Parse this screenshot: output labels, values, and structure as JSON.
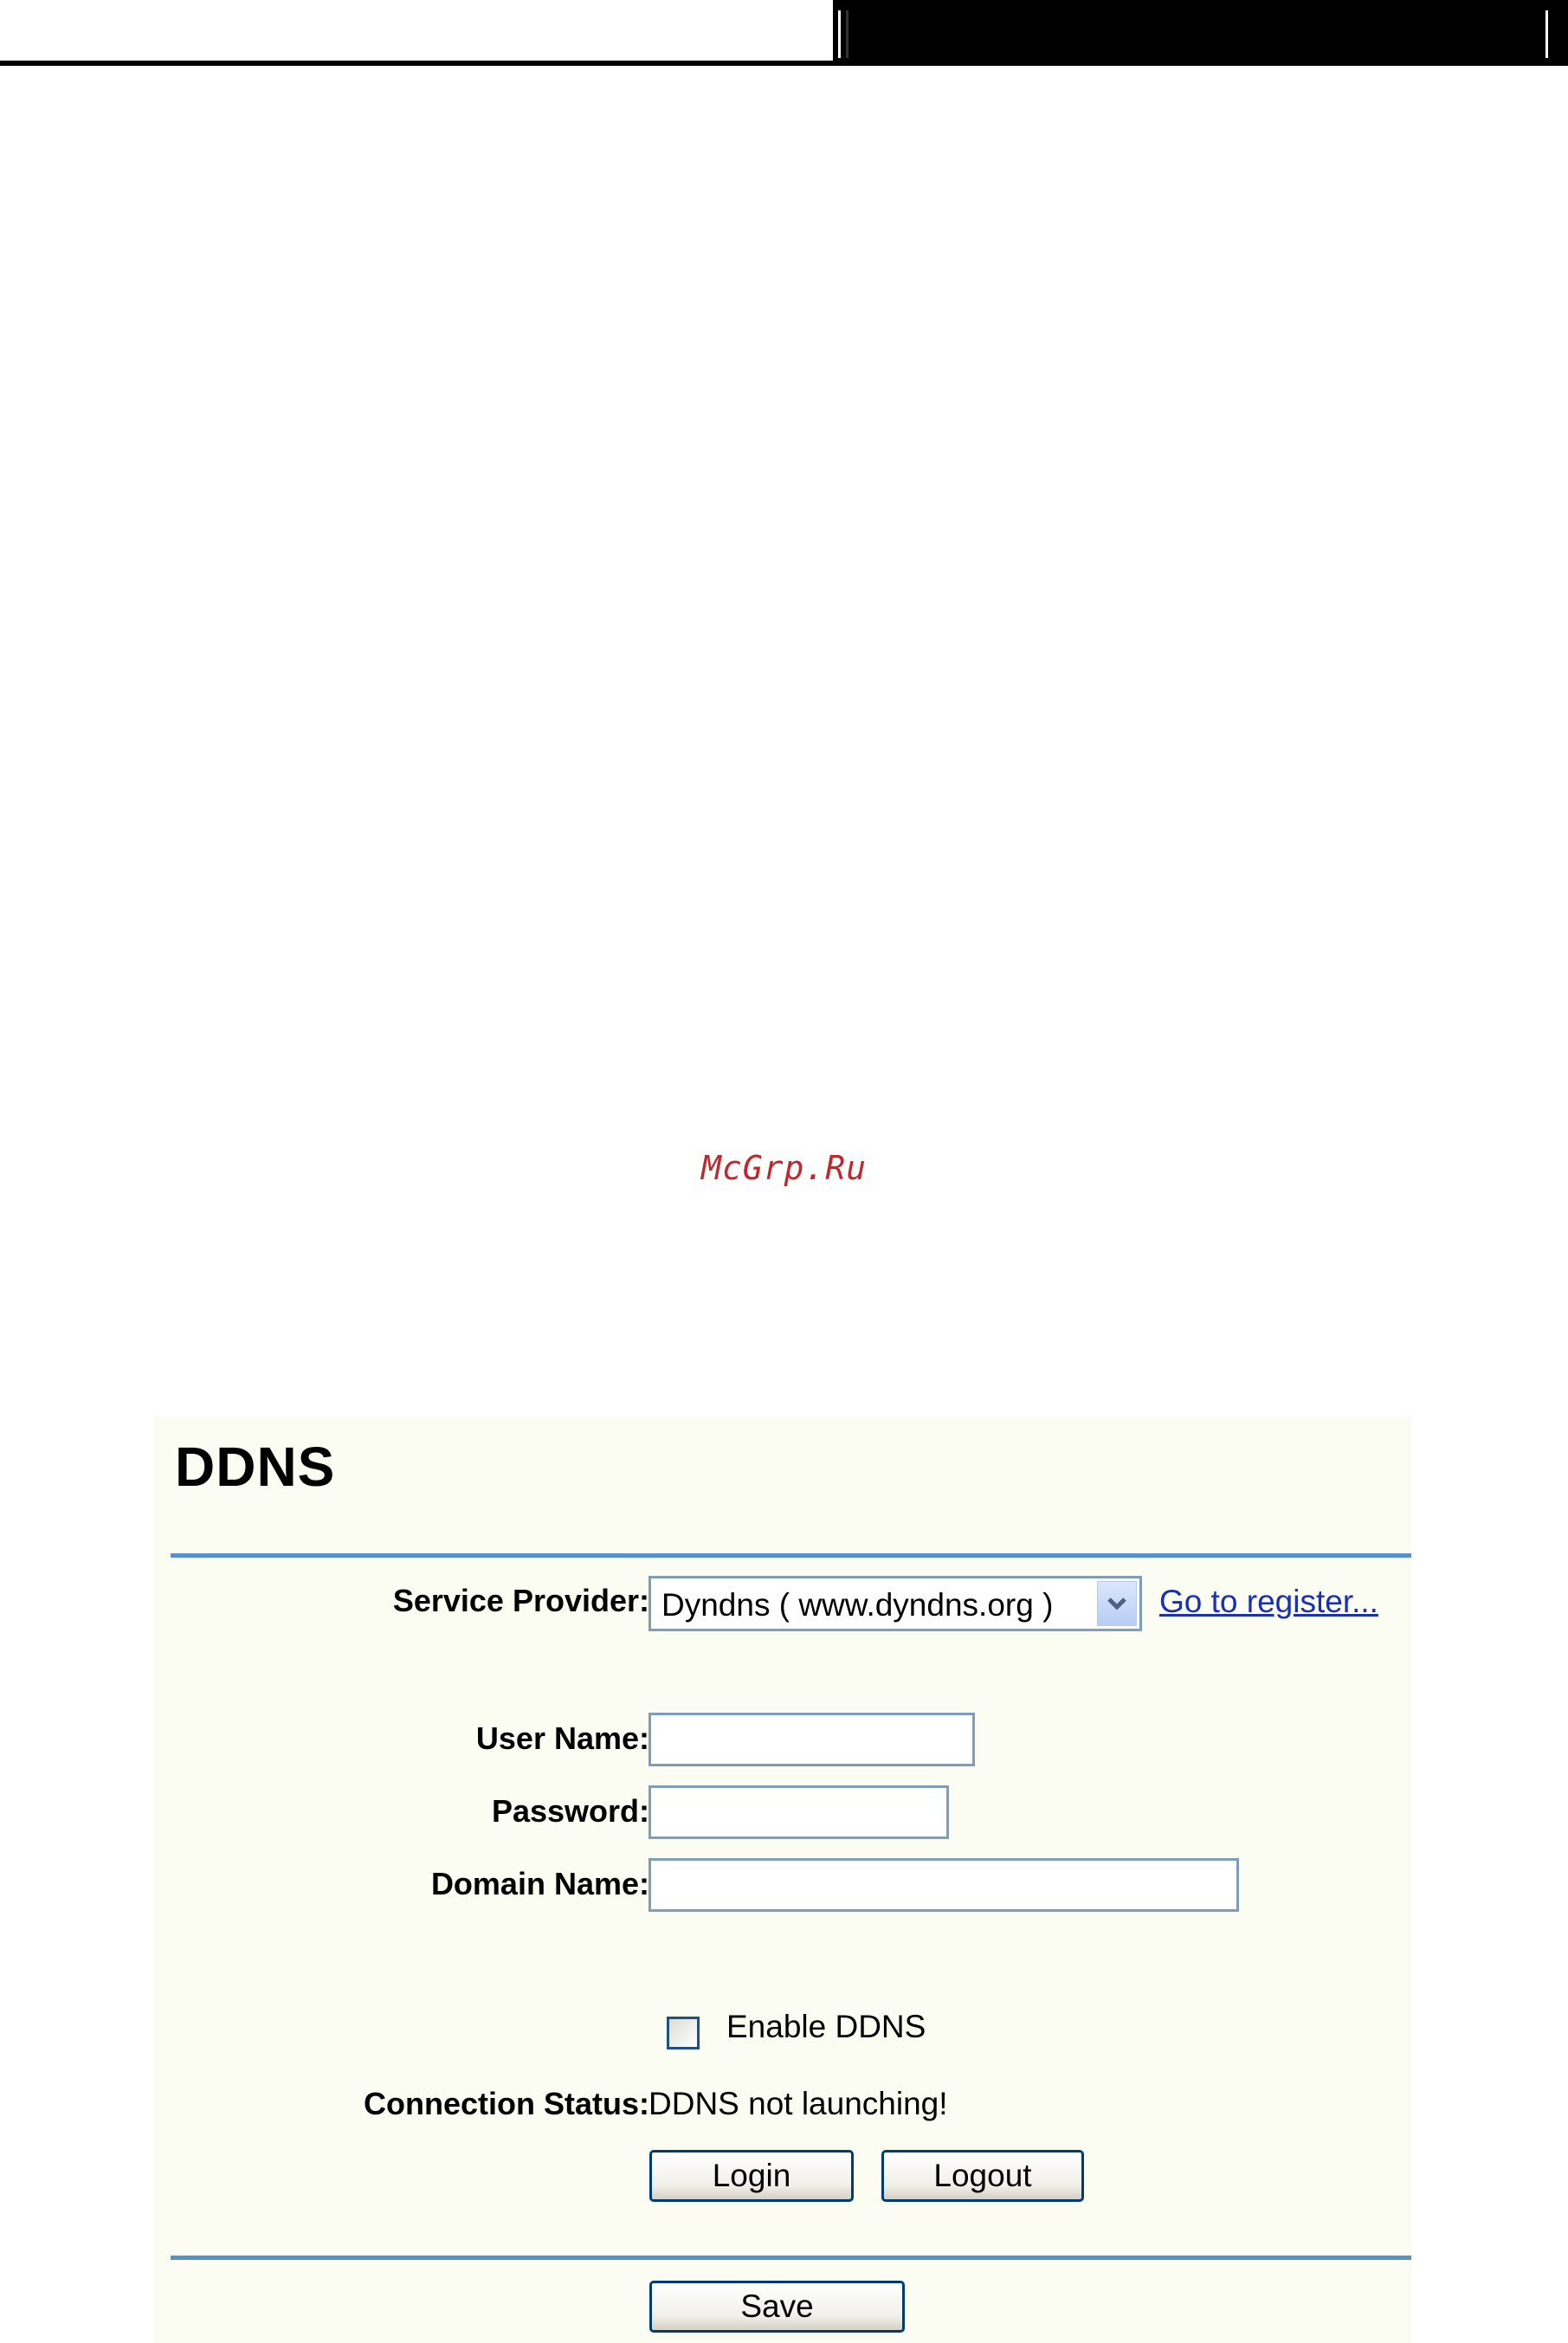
{
  "watermark": "McGrp.Ru",
  "panel": {
    "title": "DDNS",
    "service_provider": {
      "label": "Service Provider:",
      "selected": "Dyndns ( www.dyndns.org )",
      "link": "Go to register..."
    },
    "user_name": {
      "label": "User Name:",
      "value": ""
    },
    "password": {
      "label": "Password:",
      "value": ""
    },
    "domain_name": {
      "label": "Domain Name:",
      "value": ""
    },
    "enable_ddns": {
      "label": "Enable DDNS",
      "checked": false
    },
    "connection_status": {
      "label": "Connection Status:",
      "value": "DDNS not launching!"
    },
    "buttons": {
      "login": "Login",
      "logout": "Logout",
      "save": "Save"
    }
  },
  "icons": {
    "dropdown": "chevron-down-icon"
  },
  "colors": {
    "panel_bg": "#fbfdf2",
    "rule": "#5592cc",
    "link": "#1a2fb8",
    "watermark": "#c0282d"
  }
}
